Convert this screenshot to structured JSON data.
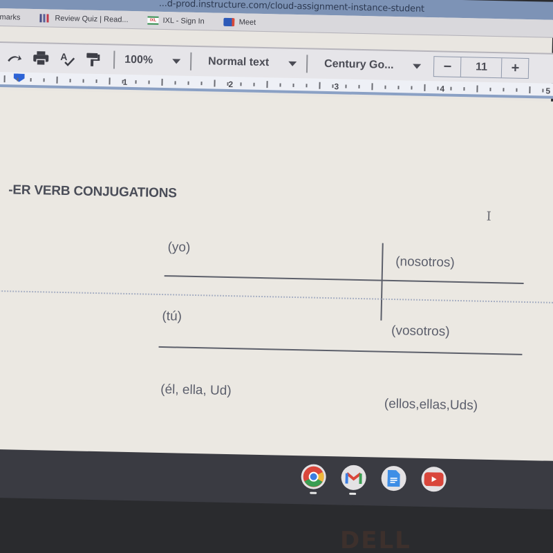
{
  "browser": {
    "url_text": "...d-prod.instructure.com/cloud-assignment-instance-student",
    "bookmarks": [
      {
        "label": "marks",
        "icon": "bookmarks-icon"
      },
      {
        "label": "Review Quiz | Read...",
        "icon": "bars-icon"
      },
      {
        "label": "IXL - Sign In",
        "icon": "ixl-icon"
      },
      {
        "label": "Meet",
        "icon": "meet-icon"
      }
    ]
  },
  "toolbar": {
    "zoom": "100%",
    "style": "Normal text",
    "font": "Century Go...",
    "font_size": "11",
    "minus": "−",
    "plus": "+"
  },
  "ruler": {
    "numbers": [
      "1",
      "2",
      "3",
      "4",
      "5"
    ]
  },
  "document": {
    "heading": "-ER VERB CONJUGATIONS",
    "cells": {
      "yo": "(yo)",
      "nosotros": "(nosotros)",
      "tu": "(tú)",
      "vosotros": "(vosotros)",
      "el": "(él, ella, Ud)",
      "ellos": "(ellos,ellas,Uds)"
    }
  },
  "shelf": {
    "apps": [
      "chrome-icon",
      "gmail-icon",
      "docs-icon",
      "youtube-icon"
    ]
  },
  "bezel": {
    "logo": "DELL"
  }
}
